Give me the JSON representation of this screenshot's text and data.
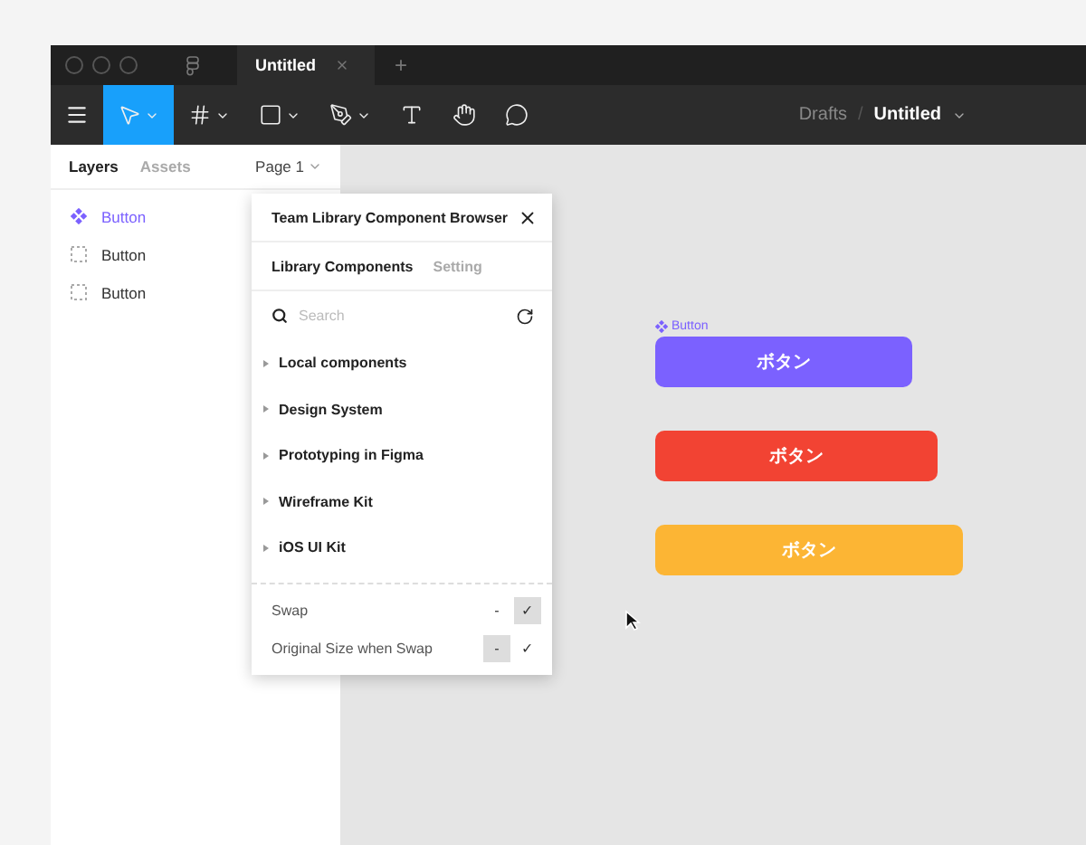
{
  "window": {
    "tab_title": "Untitled",
    "new_tab": "+"
  },
  "toolbar": {
    "tools": [
      {
        "kind": "move",
        "selected": true,
        "menu": true
      },
      {
        "kind": "frame",
        "selected": false,
        "menu": true
      },
      {
        "kind": "shape",
        "selected": false,
        "menu": true
      },
      {
        "kind": "pen",
        "selected": false,
        "menu": true
      },
      {
        "kind": "text",
        "selected": false,
        "menu": false
      },
      {
        "kind": "hand",
        "selected": false,
        "menu": false
      },
      {
        "kind": "comment",
        "selected": false,
        "menu": false
      }
    ],
    "breadcrumb": {
      "folder": "Drafts",
      "separator": "/",
      "file": "Untitled"
    }
  },
  "sidebar": {
    "tabs": [
      {
        "label": "Layers",
        "selected": true
      },
      {
        "label": "Assets",
        "selected": false
      }
    ],
    "page": "Page 1",
    "layers": [
      {
        "name": "Button",
        "kind": "component",
        "selected": true
      },
      {
        "name": "Button",
        "kind": "frame",
        "selected": false
      },
      {
        "name": "Button",
        "kind": "frame",
        "selected": false
      }
    ]
  },
  "plugin": {
    "title": "Team Library Component Browser",
    "tabs": [
      {
        "label": "Library Components",
        "selected": true
      },
      {
        "label": "Setting",
        "selected": false
      }
    ],
    "search": {
      "placeholder": "Search"
    },
    "libraries": [
      {
        "name": "Local components",
        "expanded": false
      },
      {
        "name": "Design System",
        "expanded": false
      },
      {
        "name": "Prototyping in Figma",
        "expanded": false
      },
      {
        "name": "Wireframe Kit",
        "expanded": false
      },
      {
        "name": "iOS UI Kit",
        "expanded": false
      }
    ],
    "options": [
      {
        "label": "Swap",
        "choices": [
          {
            "label": "-",
            "selected": false
          },
          {
            "label": "✓",
            "selected": true
          }
        ]
      },
      {
        "label": "Original Size when Swap",
        "choices": [
          {
            "label": "-",
            "selected": true
          },
          {
            "label": "✓",
            "selected": false
          }
        ]
      }
    ]
  },
  "canvas": {
    "selection_label": "Button",
    "buttons": [
      {
        "label": "ボタン",
        "color": "#7b61ff"
      },
      {
        "label": "ボタン",
        "color": "#f24333"
      },
      {
        "label": "ボタン",
        "color": "#fcb534"
      }
    ]
  }
}
